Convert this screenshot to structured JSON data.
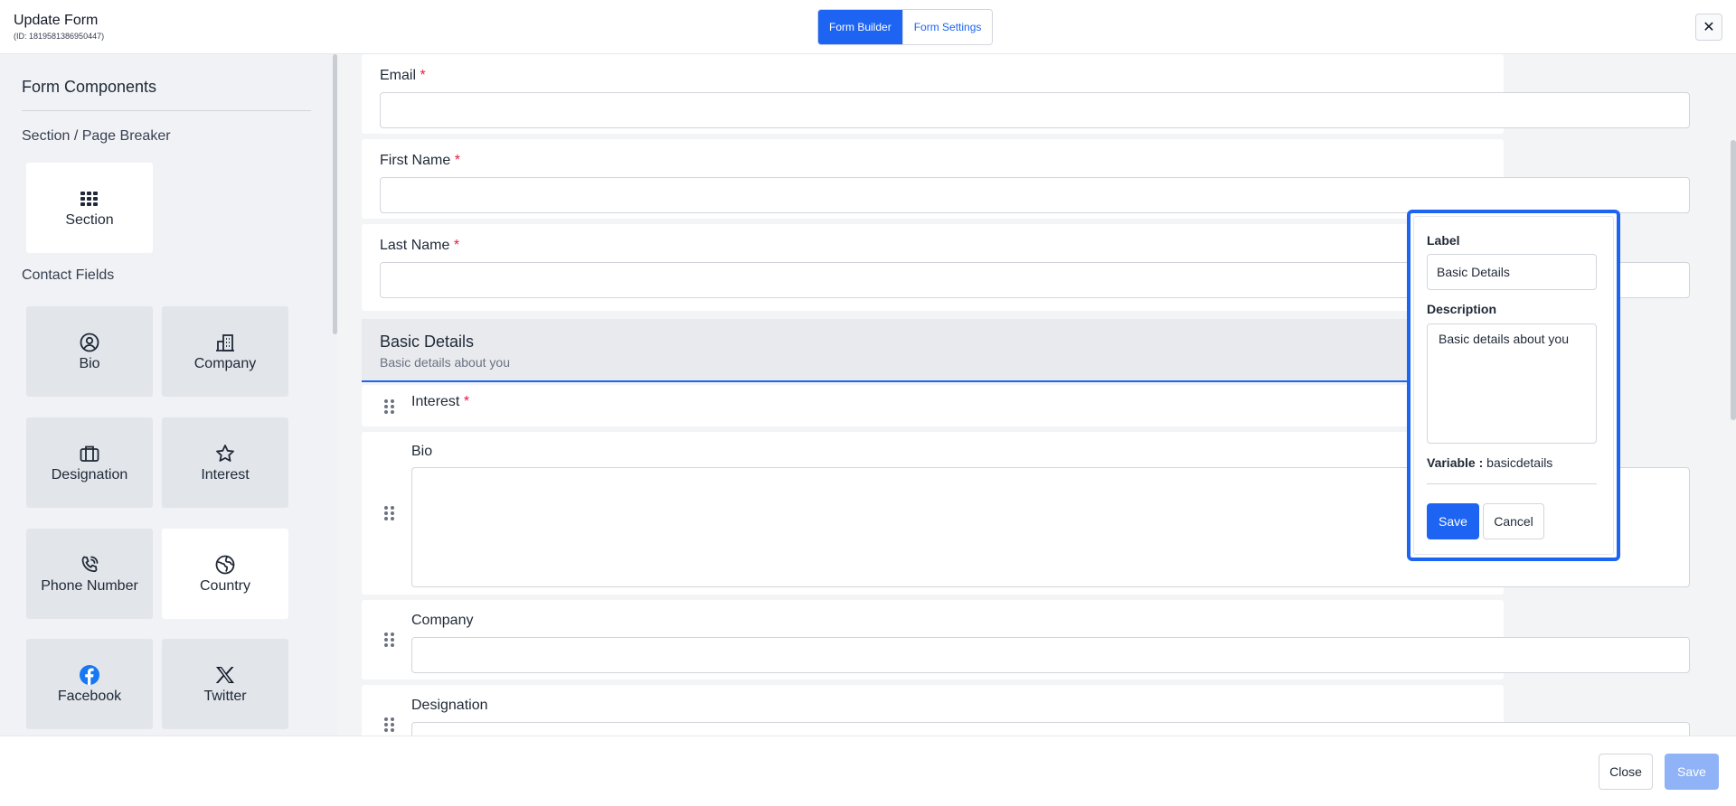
{
  "header": {
    "title": "Update Form",
    "subtitle": "(ID: 1819581386950447)",
    "tabs": [
      "Form Builder",
      "Form Settings"
    ],
    "close_glyph": "✕"
  },
  "sidebar": {
    "heading": "Form Components",
    "groups": [
      "Section / Page Breaker",
      "Contact Fields"
    ],
    "section_tile": "Section",
    "contact_tiles": [
      "Bio",
      "Company",
      "Designation",
      "Interest",
      "Phone Number",
      "Country",
      "Facebook",
      "Twitter"
    ],
    "icons": [
      "grid-icon",
      "user-circle-icon",
      "building-icon",
      "briefcase-icon",
      "star-icon",
      "phone-icon",
      "globe-icon",
      "facebook-icon",
      "x-twitter-icon"
    ]
  },
  "main": {
    "fields": {
      "email": "Email",
      "first_name": "First Name",
      "last_name": "Last Name",
      "required_mark": "*"
    },
    "section": {
      "title": "Basic Details",
      "description": "Basic details about you"
    },
    "section_fields": {
      "interest": "Interest",
      "bio": "Bio",
      "company": "Company",
      "designation": "Designation"
    }
  },
  "popover": {
    "label_heading": "Label",
    "label_value": "Basic Details",
    "description_heading": "Description",
    "description_value": "Basic details about you",
    "variable_key": "Variable :",
    "variable_value": "basicdetails",
    "save": "Save",
    "cancel": "Cancel"
  },
  "footer": {
    "close": "Close",
    "save": "Save"
  },
  "colors": {
    "accent": "#1d64f2",
    "required": "#e11d48",
    "sidebar_bg": "#f1f2f5"
  }
}
